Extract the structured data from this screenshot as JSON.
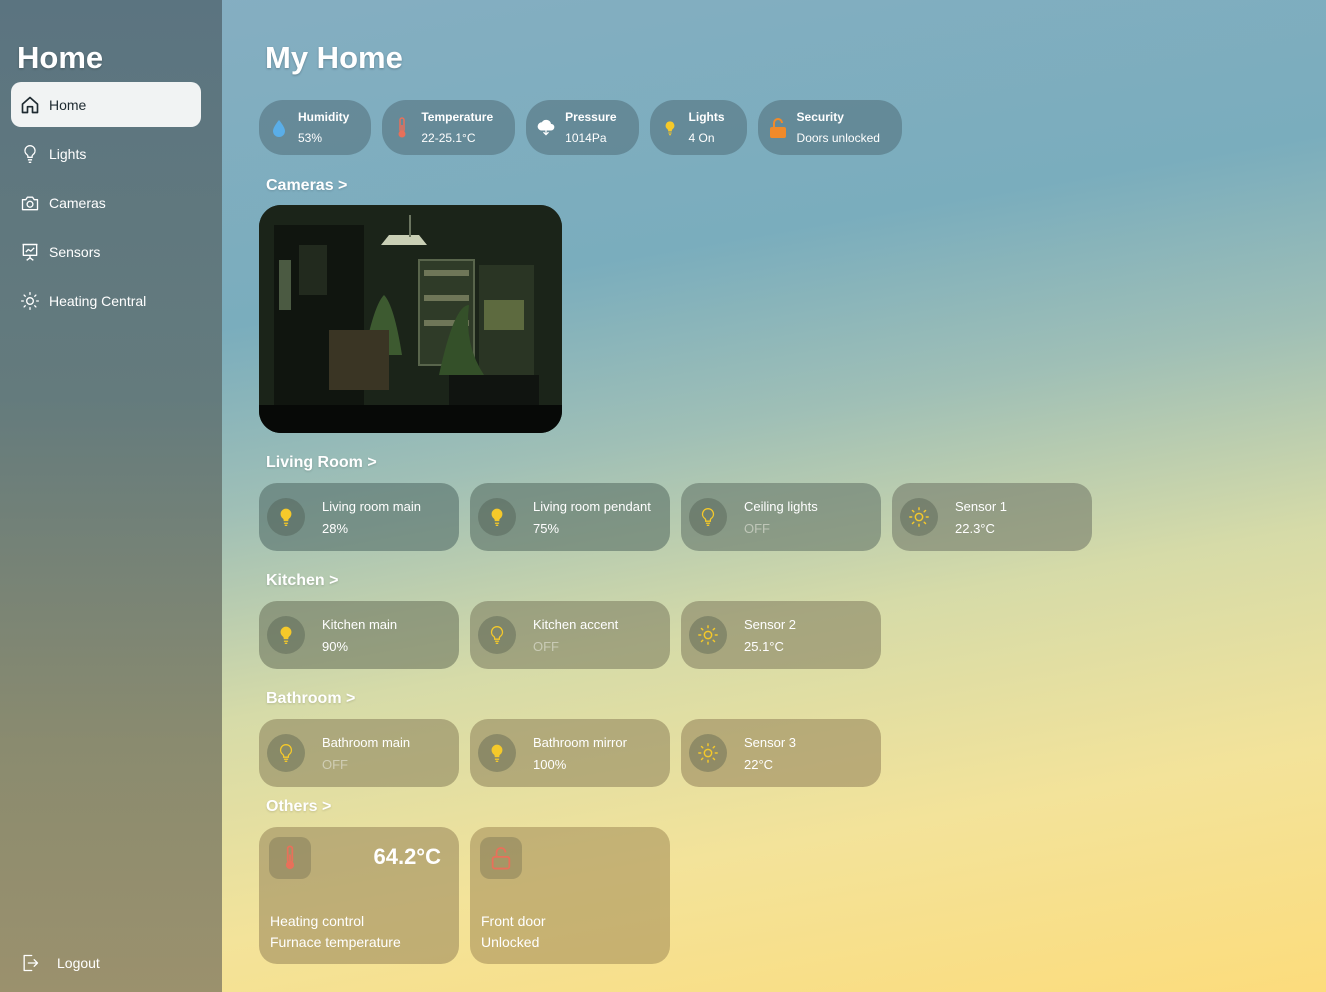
{
  "sidebar": {
    "title": "Home",
    "items": [
      {
        "label": "Home",
        "icon": "home-icon",
        "active": true
      },
      {
        "label": "Lights",
        "icon": "bulb-icon"
      },
      {
        "label": "Cameras",
        "icon": "camera-icon"
      },
      {
        "label": "Sensors",
        "icon": "chart-icon"
      },
      {
        "label": "Heating Central",
        "icon": "sun-icon"
      }
    ],
    "logout": "Logout"
  },
  "main": {
    "title": "My Home",
    "stats": [
      {
        "title": "Humidity",
        "value": "53%",
        "icon": "droplet-icon"
      },
      {
        "title": "Temperature",
        "value": "22-25.1°C",
        "icon": "thermometer-icon"
      },
      {
        "title": "Pressure",
        "value": "1014Pa",
        "icon": "cloud-icon"
      },
      {
        "title": "Lights",
        "value": "4 On",
        "icon": "bulb-icon"
      },
      {
        "title": "Security",
        "value": "Doors unlocked",
        "icon": "unlock-icon"
      }
    ],
    "sections": {
      "cameras": "Cameras >",
      "living_room": "Living Room >",
      "kitchen": "Kitchen >",
      "bathroom": "Bathroom >",
      "others": "Others >"
    },
    "living_room": [
      {
        "name": "Living room main",
        "value": "28%",
        "icon": "bulb-icon",
        "on": true
      },
      {
        "name": "Living room pendant",
        "value": "75%",
        "icon": "bulb-icon",
        "on": true
      },
      {
        "name": "Ceiling lights",
        "value": "OFF",
        "icon": "bulb-outline-icon",
        "on": false
      },
      {
        "name": "Sensor 1",
        "value": "22.3°C",
        "icon": "sun-icon",
        "on": true
      }
    ],
    "kitchen": [
      {
        "name": "Kitchen main",
        "value": "90%",
        "icon": "bulb-icon",
        "on": true
      },
      {
        "name": "Kitchen accent",
        "value": "OFF",
        "icon": "bulb-outline-icon",
        "on": false
      },
      {
        "name": "Sensor 2",
        "value": "25.1°C",
        "icon": "sun-icon",
        "on": true
      }
    ],
    "bathroom": [
      {
        "name": "Bathroom main",
        "value": "OFF",
        "icon": "bulb-outline-icon",
        "on": false
      },
      {
        "name": "Bathroom mirror",
        "value": "100%",
        "icon": "bulb-icon",
        "on": true
      },
      {
        "name": "Sensor 3",
        "value": "22°C",
        "icon": "sun-icon",
        "on": true
      }
    ],
    "others": [
      {
        "name": "Heating control",
        "sub": "Furnace temperature",
        "value": "64.2°C",
        "icon": "thermometer-icon"
      },
      {
        "name": "Front door",
        "sub": "Unlocked",
        "value": "",
        "icon": "unlock-icon"
      }
    ]
  },
  "colors": {
    "accent_yellow": "#f5c92a",
    "warning_red": "#e8705a",
    "security_orange": "#f08a2a"
  }
}
